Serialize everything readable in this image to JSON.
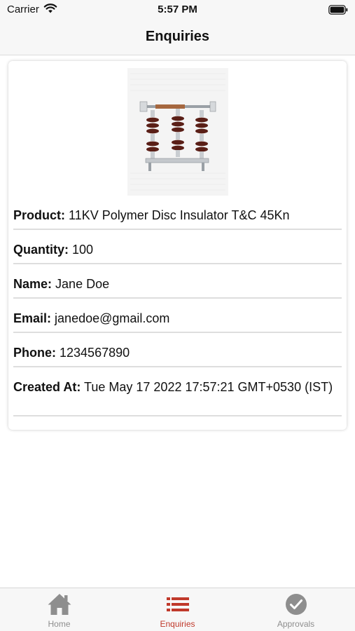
{
  "status_bar": {
    "carrier": "Carrier",
    "time": "5:57 PM"
  },
  "nav": {
    "title": "Enquiries"
  },
  "enquiry": {
    "fields": [
      {
        "key": "Product:",
        "value": "11KV Polymer Disc Insulator T&C 45Kn"
      },
      {
        "key": "Quantity:",
        "value": "100"
      },
      {
        "key": "Name:",
        "value": "Jane Doe"
      },
      {
        "key": "Email:",
        "value": "janedoe@gmail.com"
      },
      {
        "key": "Phone:",
        "value": "1234567890"
      },
      {
        "key": "Created At:",
        "value": "Tue May 17 2022 17:57:21 GMT+0530 (IST)"
      }
    ]
  },
  "tab_bar": {
    "tabs": [
      {
        "label": "Home",
        "icon": "home-icon",
        "active": false
      },
      {
        "label": "Enquiries",
        "icon": "list-icon",
        "active": true
      },
      {
        "label": "Approvals",
        "icon": "check-circle-icon",
        "active": false
      }
    ]
  },
  "colors": {
    "accent": "#c0392b",
    "inactive": "#8e8e8e"
  }
}
